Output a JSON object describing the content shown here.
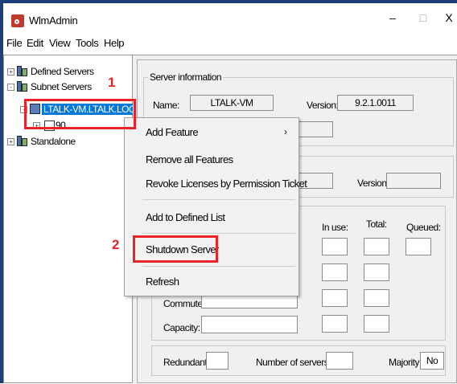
{
  "window": {
    "title": "WlmAdmin",
    "minimize": "–",
    "maximize": "□",
    "close": "X"
  },
  "menu": [
    "File",
    "Edit",
    "View",
    "Tools",
    "Help"
  ],
  "tree": {
    "defined_servers": "Defined Servers",
    "subnet_servers": "Subnet Servers",
    "selected_server": "LTALK-VM.LTALK.LOCAL",
    "child_item": "90",
    "standalone": "Standalone"
  },
  "annotations": {
    "marker1": "1",
    "marker2": "2"
  },
  "server_info": {
    "group_title": "Server information",
    "name_label": "Name:",
    "name_value": "LTALK-VM",
    "version_label": "Version:",
    "version_value": "9.2.1.0011"
  },
  "feature_info": {
    "version_label": "Version:",
    "in_use_label": "In use:",
    "total_label": "Total:",
    "queued_label": "Queued:",
    "commuter_label": "Commuter:",
    "capacity_label": "Capacity:"
  },
  "footer": {
    "redundant_label": "Redundant:",
    "num_servers_label": "Number of servers:",
    "majority_label": "Majority:",
    "majority_value": "No"
  },
  "context_menu": {
    "items": [
      "Add Feature",
      "Remove all Features",
      "Revoke Licenses by Permission Ticket",
      "Add to Defined List",
      "Shutdown Server",
      "Refresh"
    ],
    "submenu_arrow": "›"
  },
  "colors": {
    "annotation_red": "#e8232a",
    "selection_blue": "#0078d7"
  }
}
